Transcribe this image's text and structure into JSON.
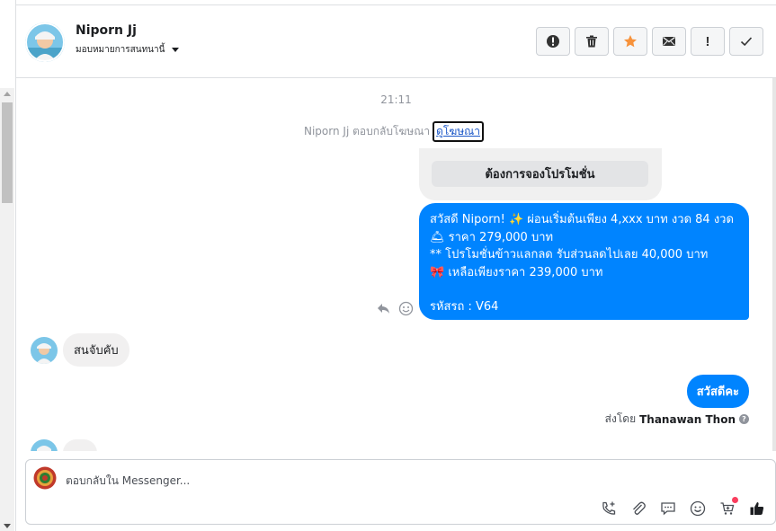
{
  "header": {
    "contact_name": "Niporn Jj",
    "assign_label": "มอบหมายการสนทนานี้",
    "actions": [
      {
        "name": "spam-button",
        "icon": "alert-circle-icon"
      },
      {
        "name": "delete-button",
        "icon": "trash-icon"
      },
      {
        "name": "star-button",
        "icon": "star-icon",
        "color": "#f7923b"
      },
      {
        "name": "mark-unread-button",
        "icon": "envelope-icon"
      },
      {
        "name": "follow-up-button",
        "icon": "exclamation-icon",
        "text": "!"
      },
      {
        "name": "mark-done-button",
        "icon": "check-icon"
      }
    ]
  },
  "thread": {
    "timestamp": "21:11",
    "ad_reply_prefix": "Niporn Jj ตอบกลับโฆษณา",
    "ad_reply_link": "ดูโฆษณา",
    "ad_cta": "ต้องการจองโปรโมชั่น",
    "promo_message": {
      "line1": "สวัสดี Niporn! ✨  ผ่อนเริ่มต้นเพียง 4,xxx บาท งวด 84 งวด",
      "line2": "🛎 ราคา 279,000 บาท",
      "line3": "** โปรโมชั่นข้าวแลกลด รับส่วนลดไปเลย 40,000 บาท",
      "line4": "🎀  เหลือเพียงราคา 239,000 บาท",
      "line5": "รหัสรถ : V64"
    },
    "incoming_message": "สนจับคับ",
    "outgoing_short": "สวัสดีคะ",
    "sent_by_prefix": "ส่งโดย",
    "sent_by_name": "Thanawan Thon",
    "sent_by_help": "?"
  },
  "composer": {
    "placeholder": "ตอบกลับใน Messenger...",
    "tools": [
      "add-call-icon",
      "attach-icon",
      "saved-reply-icon",
      "emoji-icon",
      "shop-cart-icon",
      "like-icon"
    ]
  },
  "colors": {
    "messenger_blue": "#0084ff",
    "incoming_bubble": "#f1f0f0",
    "star_orange": "#f7923b",
    "notification_dot": "#fa3e5e"
  }
}
